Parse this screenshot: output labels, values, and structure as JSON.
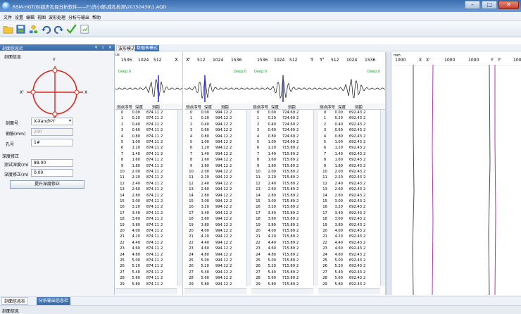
{
  "window": {
    "title": "RSM-HGT(B)超声孔径分析软件——F:\\济小部\\成孔检测\\20150430\\1.AQD",
    "controls": [
      "–",
      "□",
      "✕"
    ]
  },
  "menubar": {
    "items": [
      "文件",
      "设置",
      "编辑",
      "视图",
      "波形处理",
      "分析与输出",
      "帮助"
    ]
  },
  "toolbar": {
    "icons": [
      "open-folder-icon",
      "save-icon",
      "network-icon",
      "undo-icon",
      "redo-icon",
      "check-icon",
      "export-icon"
    ],
    "colors": {
      "folder": "#f2c43a",
      "save": "#3a7bd5",
      "check": "#3fae2a",
      "arrow": "#2a5ea8"
    }
  },
  "left_panel": {
    "title": "剖面信息栏",
    "title_controls": [
      "▾",
      "ɪ",
      "✕"
    ],
    "section_title": "剖面信息",
    "compass": {
      "n": "Y",
      "s": "Y'",
      "w": "X'",
      "e": "X",
      "color": "#d8281e"
    },
    "fields": [
      {
        "label": "剖面号",
        "value": "X-XandY-Y'",
        "type": "select"
      },
      {
        "label": "钢筋(mm)",
        "value": "200",
        "type": "disabled"
      },
      {
        "label": "孔号",
        "value": "1#",
        "type": "text"
      }
    ],
    "depth_title": "深度修正",
    "depth_fields": [
      {
        "label": "测试深度(m)",
        "value": "88.00"
      },
      {
        "label": "深度修正(m)",
        "value": "0.00"
      }
    ],
    "button": "提升深度修正"
  },
  "doc_tabs": [
    "波形模式",
    "数据表模式"
  ],
  "columns": [
    "测点序号",
    "深度",
    "测距"
  ],
  "rows": [
    [
      "0",
      "0.00"
    ],
    [
      "1",
      "0.20"
    ],
    [
      "2",
      "0.40"
    ],
    [
      "3",
      "0.60"
    ],
    [
      "4",
      "0.80"
    ],
    [
      "5",
      "1.00"
    ],
    [
      "6",
      "1.20"
    ],
    [
      "7",
      "1.40"
    ],
    [
      "8",
      "1.60"
    ],
    [
      "9",
      "1.80"
    ],
    [
      "10",
      "2.00"
    ],
    [
      "11",
      "2.20"
    ],
    [
      "12",
      "2.40"
    ],
    [
      "13",
      "2.60"
    ],
    [
      "14",
      "2.80"
    ],
    [
      "15",
      "3.00"
    ],
    [
      "16",
      "3.20"
    ],
    [
      "17",
      "3.40"
    ],
    [
      "18",
      "3.60"
    ],
    [
      "19",
      "3.80"
    ],
    [
      "20",
      "4.00"
    ],
    [
      "21",
      "4.20"
    ],
    [
      "22",
      "4.40"
    ],
    [
      "23",
      "4.60"
    ],
    [
      "24",
      "4.80"
    ],
    [
      "25",
      "5.00"
    ],
    [
      "26",
      "5.20"
    ],
    [
      "27",
      "5.40"
    ],
    [
      "28",
      "5.60"
    ],
    [
      "29",
      "5.80"
    ]
  ],
  "channels": [
    {
      "dir": "X",
      "unit": "us",
      "ticks": [
        "1536",
        "1024",
        "512"
      ],
      "deep": "Deep:0",
      "distance": "874.11",
      "flag": "2",
      "marker_color": "#2a3ad8"
    },
    {
      "dir": "X'",
      "unit": "",
      "ticks": [
        "512",
        "1024",
        "1536"
      ],
      "deep": "Deep:0",
      "distance": "994.12",
      "flag": "2",
      "marker_color": "#2a3ad8"
    },
    {
      "dir": "Y",
      "unit": "",
      "ticks": [
        "1536",
        "1024",
        "512"
      ],
      "deep": "Deep:0",
      "distance_top": [
        "724.69",
        "724.69",
        "724.69",
        "724.69",
        "724.69",
        "724.69"
      ],
      "distance": "715.89",
      "flag": "2",
      "marker_color": "#2a3ad8"
    },
    {
      "dir": "Y'",
      "unit": "",
      "ticks": [
        "512",
        "1024",
        "1536"
      ],
      "deep": "Deep:0",
      "distance": "692.43",
      "flag": "2",
      "marker_color": "#2a3ad8"
    }
  ],
  "curve_panel": {
    "unit": "mm",
    "ticks": [
      "1000",
      "X",
      "X'",
      "1000",
      "1000",
      "Y",
      "Y'",
      "100"
    ],
    "line_colors": [
      "#4a4a4a",
      "#b03aa8",
      "#4a4a4a",
      "#b03aa8"
    ]
  },
  "bottom_tabs": [
    "剖面信息栏",
    "分析输出信息栏"
  ],
  "status": "剖面信息"
}
